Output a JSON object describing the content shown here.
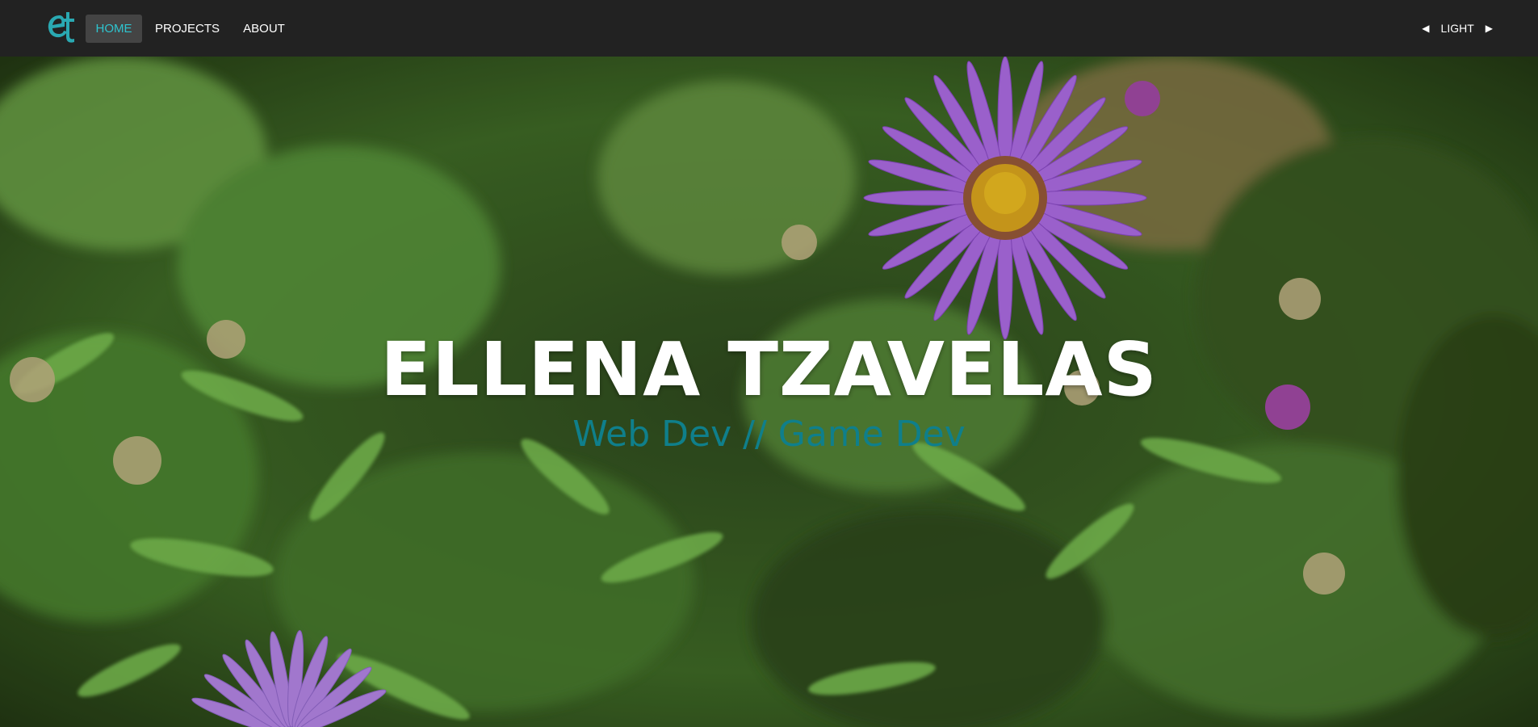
{
  "nav": {
    "items": [
      {
        "label": "HOME",
        "active": true
      },
      {
        "label": "PROJECTS",
        "active": false
      },
      {
        "label": "ABOUT",
        "active": false
      }
    ],
    "theme": {
      "label": "LIGHT",
      "prev_icon": "triangle-left-icon",
      "next_icon": "triangle-right-icon"
    },
    "logo_icon": "et-monogram-logo"
  },
  "hero": {
    "title": "ELLENA TZAVELAS",
    "subtitle": "Web Dev // Game Dev",
    "background": "purple aster flowers among green foliage"
  },
  "colors": {
    "navbar": "#222222",
    "accent": "#2ec4cf",
    "subtitle": "#0f7f8b",
    "active_tab_bg": "#444444"
  }
}
